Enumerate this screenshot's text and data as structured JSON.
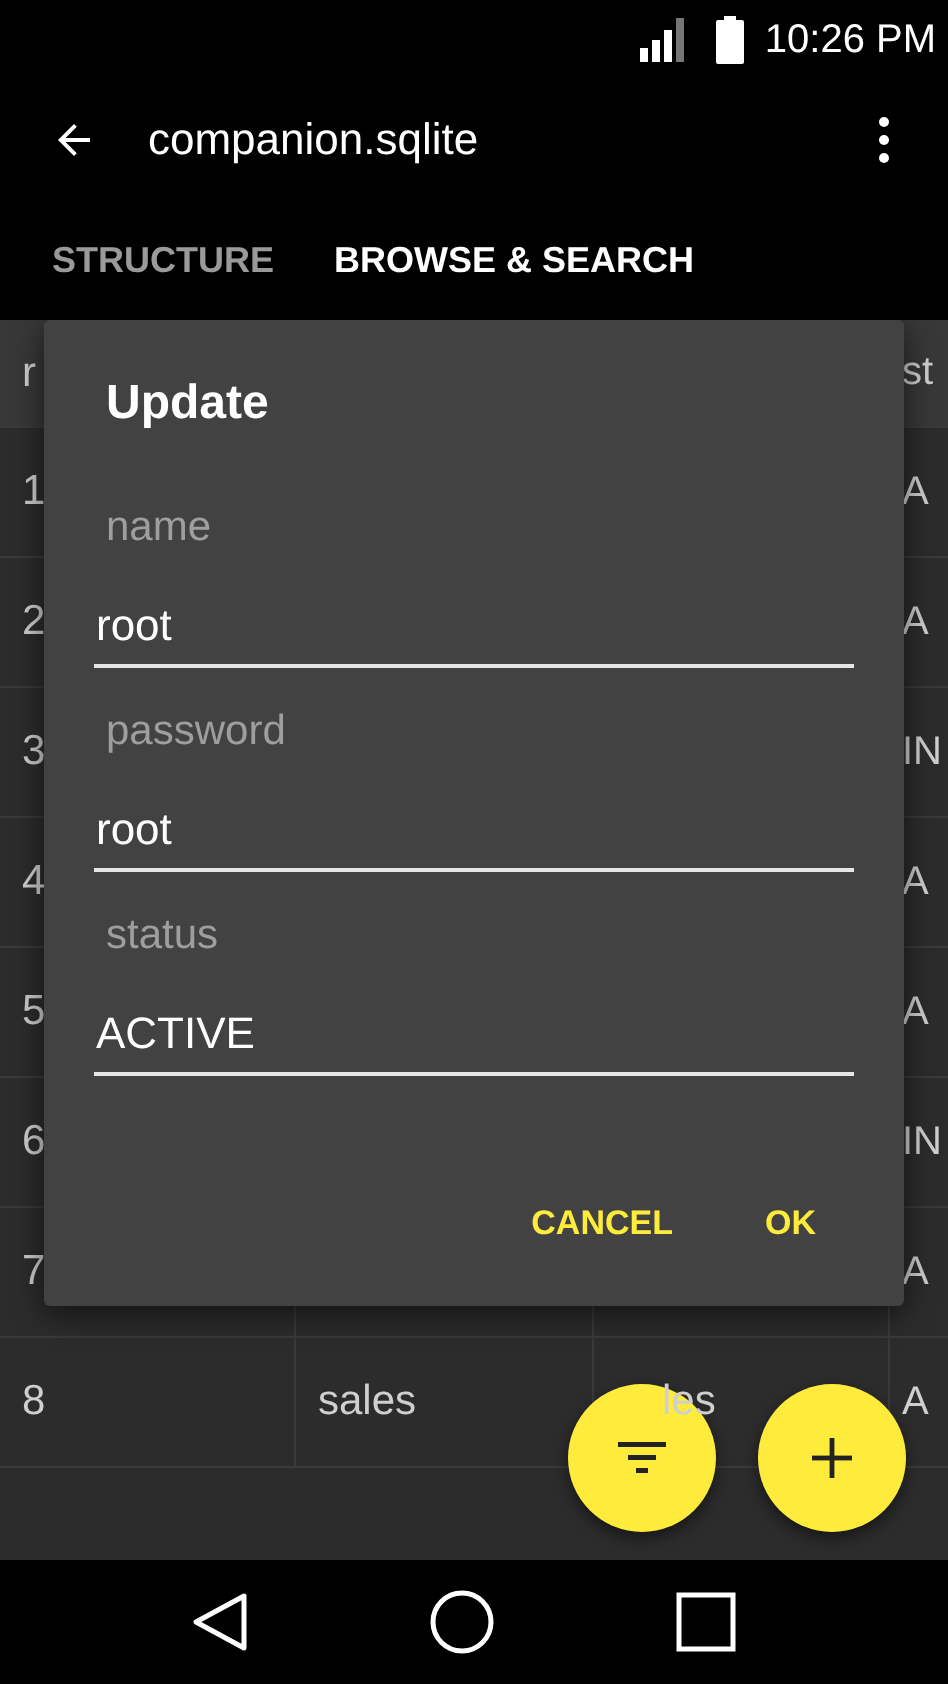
{
  "status_bar": {
    "time": "10:26 PM"
  },
  "app_bar": {
    "title": "companion.sqlite"
  },
  "tabs": [
    {
      "label": "STRUCTURE",
      "selected": false
    },
    {
      "label": "BROWSE & SEARCH",
      "selected": true
    }
  ],
  "table": {
    "header": {
      "column_1": "r",
      "column_4": "st"
    },
    "rows": [
      {
        "column_1": "1",
        "column_4": "A"
      },
      {
        "column_1": "2",
        "column_4": "A"
      },
      {
        "column_1": "3",
        "column_4": "IN"
      },
      {
        "column_1": "4",
        "column_4": "A"
      },
      {
        "column_1": "5",
        "column_4": "A"
      },
      {
        "column_1": "6",
        "column_4": "IN"
      },
      {
        "column_1": "7",
        "column_4": "A"
      },
      {
        "column_1": "8",
        "column_2": "sales",
        "column_3": "les",
        "column_4": "A"
      }
    ]
  },
  "dialog": {
    "title": "Update",
    "fields": [
      {
        "label": "name",
        "value": "root"
      },
      {
        "label": "password",
        "value": "root"
      },
      {
        "label": "status",
        "value": "ACTIVE"
      }
    ],
    "buttons": [
      "CANCEL",
      "OK"
    ]
  }
}
